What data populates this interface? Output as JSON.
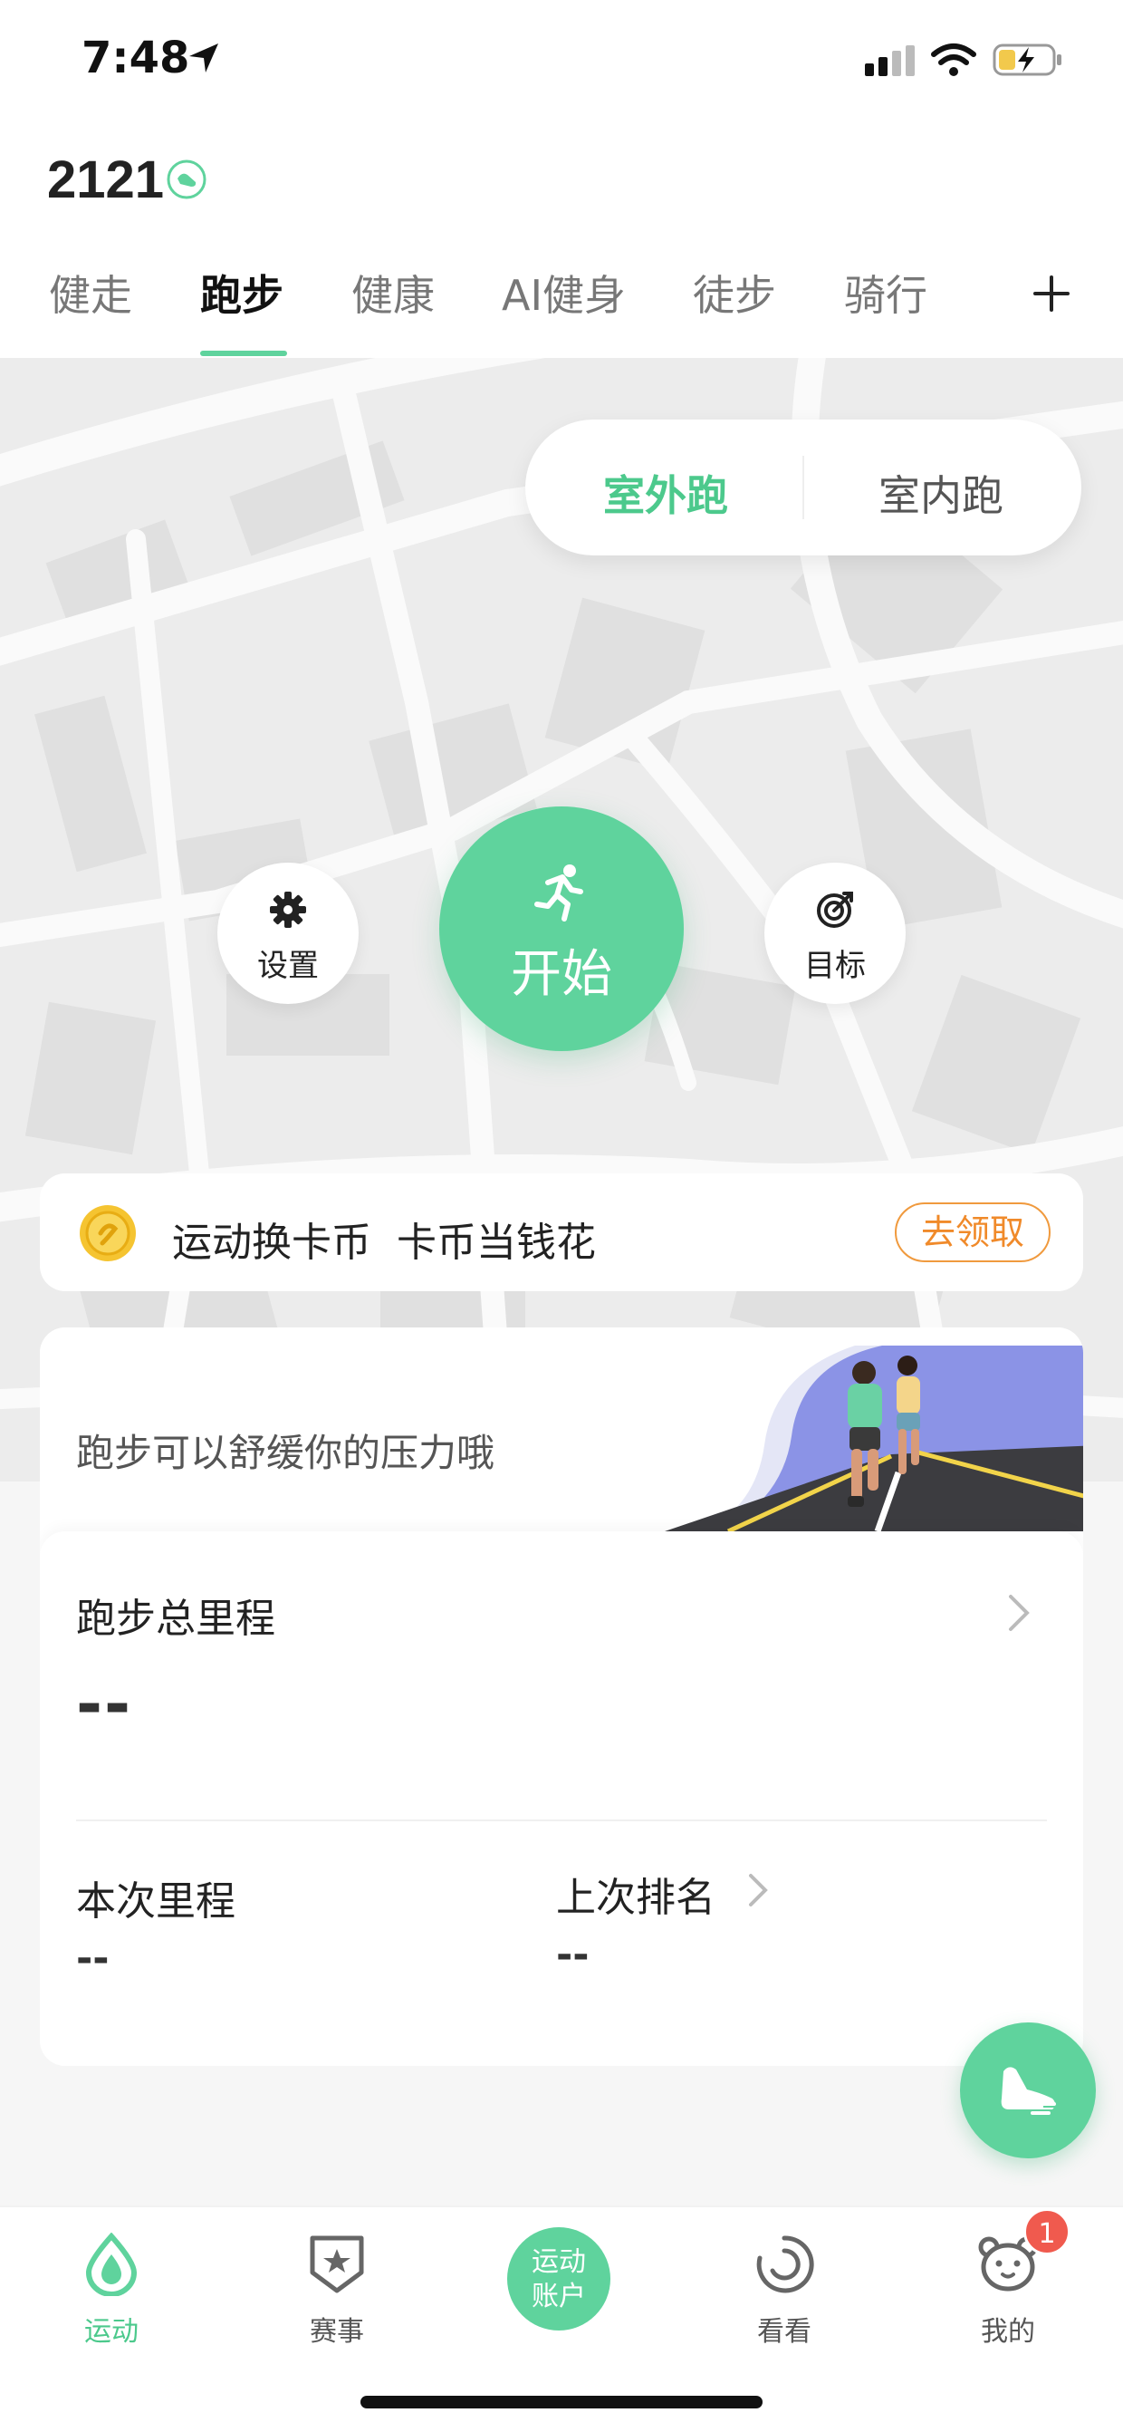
{
  "status_bar": {
    "time": "7:48"
  },
  "header": {
    "steps": "2121",
    "tabs": [
      {
        "label": "健走"
      },
      {
        "label": "跑步"
      },
      {
        "label": "健康"
      },
      {
        "label": "AI健身"
      },
      {
        "label": "徒步"
      },
      {
        "label": "骑行"
      }
    ],
    "active_tab": "跑步"
  },
  "run_mode": {
    "outdoor": "室外跑",
    "indoor": "室内跑",
    "selected": "室外跑"
  },
  "controls": {
    "settings": "设置",
    "start": "开始",
    "goal": "目标"
  },
  "coin_banner": {
    "text": "运动换卡币  卡币当钱花",
    "claim": "去领取"
  },
  "promo": {
    "text": "跑步可以舒缓你的压力哦"
  },
  "stats": {
    "total_label": "跑步总里程",
    "total_value": "--",
    "current_label": "本次里程",
    "current_value": "--",
    "rank_label": "上次排名",
    "rank_value": "--"
  },
  "bottom_nav": {
    "items": [
      {
        "label": "运动",
        "icon": "sport-drop-icon"
      },
      {
        "label": "赛事",
        "icon": "event-badge-icon"
      },
      {
        "label": "运动账户",
        "icon": "account-circle"
      },
      {
        "label": "看看",
        "icon": "watch-spiral-icon"
      },
      {
        "label": "我的",
        "icon": "profile-bear-icon"
      }
    ],
    "active": "运动",
    "center_line1": "运动",
    "center_line2": "账户",
    "profile_badge": "1"
  },
  "colors": {
    "accent": "#5fd39d",
    "accent_text": "#4cc98c",
    "claim": "#f08a2a",
    "badge": "#f05a4e"
  }
}
